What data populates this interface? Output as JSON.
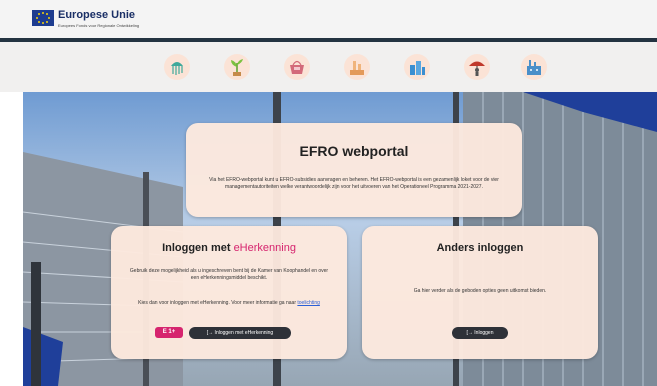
{
  "header": {
    "brand_title": "Europese Unie",
    "brand_subtitle": "Europees Fonds voor Regionale Ontwikkeling"
  },
  "icons": [
    {
      "name": "jellyfish-icon"
    },
    {
      "name": "plant-icon"
    },
    {
      "name": "basket-icon"
    },
    {
      "name": "lab-icon"
    },
    {
      "name": "buildings-icon"
    },
    {
      "name": "person-umbrella-icon"
    },
    {
      "name": "factory-icon"
    }
  ],
  "portal": {
    "title": "EFRO webportal",
    "description": "Via het EFRO-webportal kunt u EFRO-subsidies aanvragen en beheren. Het EFRO-webportal is een gezamenlijk loket voor de vier managementautoriteiten welke verantwoordelijk zijn voor het uitvoeren van het Operationeel Programma 2021-2027."
  },
  "eherkenning": {
    "title_prefix": "Inloggen met ",
    "title_brand": "eHerkenning",
    "text1": "Gebruik deze mogelijkheid als u ingeschreven bent bij de Kamer van Koophandel en over een eHerkenningsmiddel beschikt.",
    "text2_prefix": "Kies dan voor inloggen met eHerkenning. Voor meer informatie ga naar ",
    "text2_link": "toelichting",
    "badge_text": "E 1+",
    "button_label": "[→ Inloggen met eHerkenning"
  },
  "anders": {
    "title": "Anders inloggen",
    "text": "Ga hier verder als de geboden opties geen uitkomst bieden.",
    "button_label": "[→ Inloggen"
  },
  "colors": {
    "card_bg": "#fde9de",
    "brand_pink": "#d6246e",
    "button_dark": "#2e3138",
    "navbar": "#233341"
  }
}
